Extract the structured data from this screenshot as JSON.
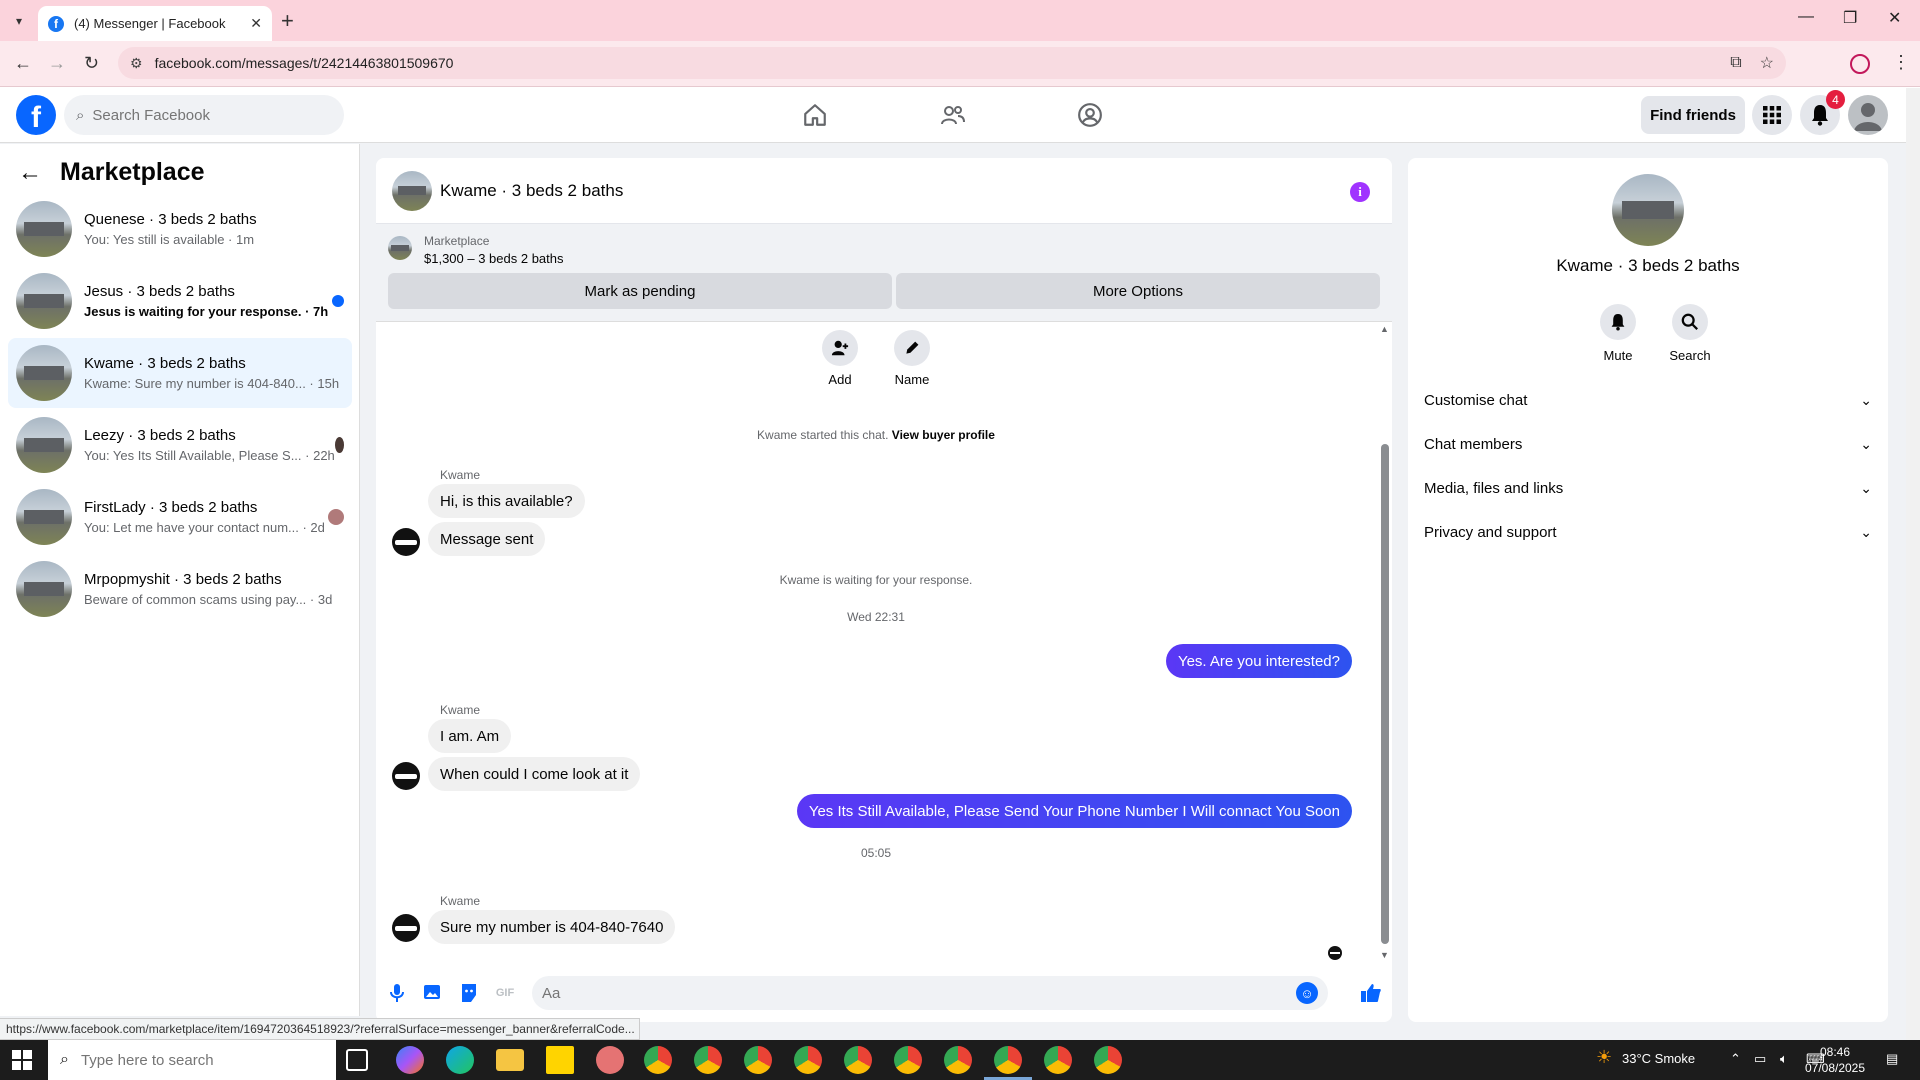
{
  "browser": {
    "tab_title": "(4) Messenger | Facebook",
    "url": "facebook.com/messages/t/24214463801509670",
    "status_url": "https://www.facebook.com/marketplace/item/1694720364518923/?referralSurface=messenger_banner&referralCode..."
  },
  "fb": {
    "search_placeholder": "Search Facebook",
    "find_friends": "Find friends",
    "notif_count": "4"
  },
  "sidebar": {
    "title": "Marketplace",
    "conversations": [
      {
        "name": "Quenese · 3 beds 2 baths",
        "preview": "You: Yes still is available · 1m",
        "unread": false,
        "indicator": "none"
      },
      {
        "name": "Jesus · 3 beds 2 baths",
        "preview": "Jesus is waiting for your response. · 7h",
        "unread": true,
        "indicator": "blue-dot"
      },
      {
        "name": "Kwame · 3 beds 2 baths",
        "preview": "Kwame: Sure my number is 404-840... · 15h",
        "unread": false,
        "indicator": "none"
      },
      {
        "name": "Leezy · 3 beds 2 baths",
        "preview": "You: Yes Its Still Available, Please S... · 22h",
        "unread": false,
        "indicator": "avatar"
      },
      {
        "name": "FirstLady · 3 beds 2 baths",
        "preview": "You: Let me have your contact num... · 2d",
        "unread": false,
        "indicator": "avatar"
      },
      {
        "name": "Mrpopmyshit · 3 beds 2 baths",
        "preview": "Beware of common scams using pay... · 3d",
        "unread": false,
        "indicator": "none"
      }
    ]
  },
  "chat": {
    "title": "Kwame · 3 beds 2 baths",
    "banner_label": "Marketplace",
    "banner_price": "$1,300 – 3 beds 2 baths",
    "mark_pending": "Mark as pending",
    "more_options": "More Options",
    "actions": [
      "Add",
      "Name"
    ],
    "started_text": "Kwame started this chat.",
    "view_buyer": "View buyer profile",
    "sender": "Kwame",
    "messages": {
      "m1": "Hi, is this available?",
      "m2": "Message sent",
      "waiting": "Kwame is waiting for your response.",
      "time1": "Wed 22:31",
      "out1": "Yes. Are you interested?",
      "m3": "I am. Am",
      "m4": "When could I come look at it",
      "out2": "Yes Its Still Available, Please Send Your Phone Number I Will connact You Soon",
      "time2": "05:05",
      "m5": "Sure my number is 404-840-7640"
    },
    "composer_placeholder": "Aa"
  },
  "panel": {
    "name": "Kwame · 3 beds 2 baths",
    "mute": "Mute",
    "search": "Search",
    "rows": [
      "Customise chat",
      "Chat members",
      "Media, files and links",
      "Privacy and support"
    ]
  },
  "taskbar": {
    "search_placeholder": "Type here to search",
    "weather": "33°C  Smoke",
    "time": "08:46",
    "date": "07/08/2025"
  },
  "colors": {
    "brand": "#0866ff",
    "outgoing_bubble": "#3a4ef2",
    "tab_strip": "#fbd3dc"
  }
}
